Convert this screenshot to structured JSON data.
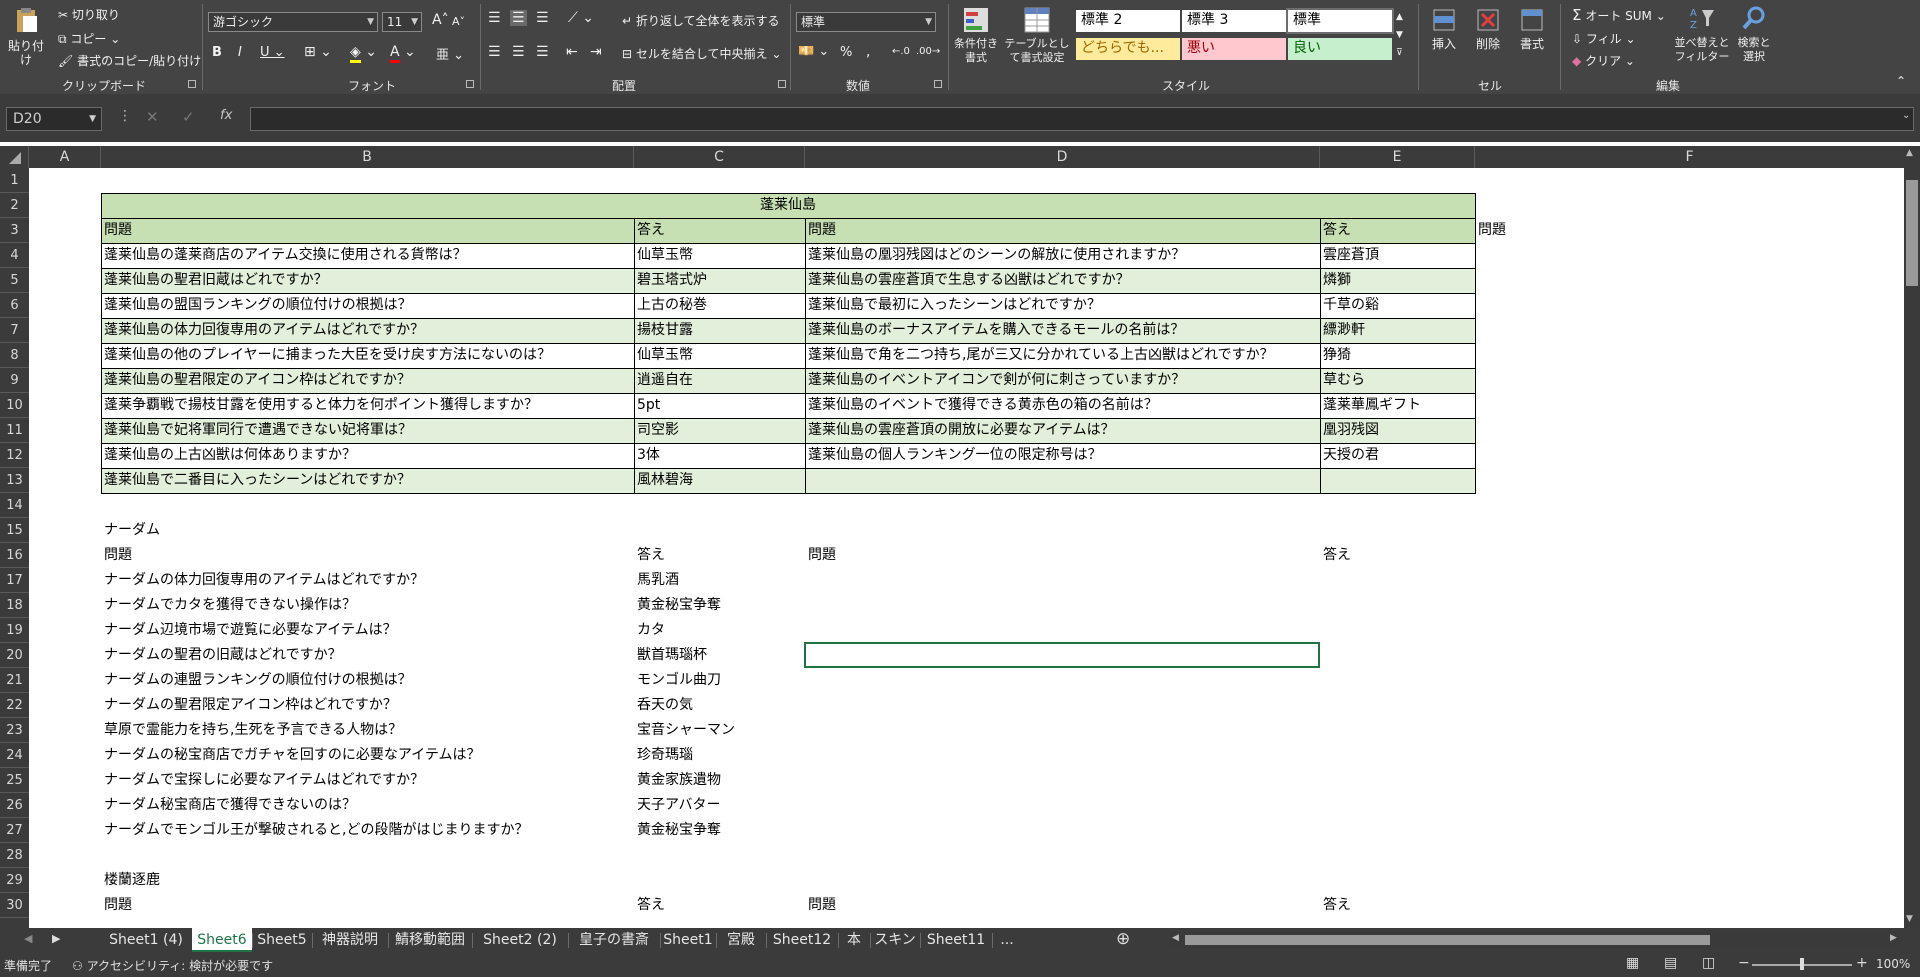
{
  "ribbon": {
    "clipboard": {
      "paste": "貼り付け",
      "cut": "切り取り",
      "copy": "コピー",
      "format_painter": "書式のコピー/貼り付け",
      "label": "クリップボード"
    },
    "font": {
      "name": "游ゴシック",
      "size": "11",
      "bold": "B",
      "italic": "I",
      "underline": "U",
      "grow": "A",
      "shrink": "A",
      "label": "フォント"
    },
    "alignment": {
      "wrap": "折り返して全体を表示する",
      "merge": "セルを結合して中央揃え",
      "label": "配置"
    },
    "number": {
      "format": "標準",
      "percent": "%",
      "comma": ",",
      "label": "数値"
    },
    "styles": {
      "conditional": "条件付き書式",
      "table": "テーブルとして書式設定",
      "items": [
        "標準 2",
        "標準 3",
        "標準",
        "どちらでも...",
        "悪い",
        "良い"
      ],
      "colors": {
        "neutral_bg": "#ffeb9c",
        "neutral_fg": "#9c6500",
        "bad_bg": "#ffc7ce",
        "bad_fg": "#9c0006",
        "good_bg": "#c6efce",
        "good_fg": "#006100"
      },
      "label": "スタイル"
    },
    "cells": {
      "insert": "挿入",
      "delete": "削除",
      "format": "書式",
      "label": "セル"
    },
    "editing": {
      "autosum": "オート SUM",
      "fill": "フィル",
      "clear": "クリア",
      "sort": "並べ替えとフィルター",
      "find": "検索と選択",
      "label": "編集"
    }
  },
  "formula_bar": {
    "name_box": "D20",
    "fx": "fx",
    "value": ""
  },
  "columns": [
    "A",
    "B",
    "C",
    "D",
    "E",
    "F"
  ],
  "rows": [
    "1",
    "2",
    "3",
    "4",
    "5",
    "6",
    "7",
    "8",
    "9",
    "10",
    "11",
    "12",
    "13",
    "14",
    "15",
    "16",
    "17",
    "18",
    "19",
    "20",
    "21",
    "22",
    "23",
    "24",
    "25",
    "26",
    "27",
    "28",
    "29",
    "30"
  ],
  "section1": {
    "title": "蓬莱仙島",
    "header_q": "問題",
    "header_a": "答え",
    "extra_header": "問題",
    "left": [
      {
        "q": "蓬莱仙島の蓬莱商店のアイテム交換に使用される貨幣は？",
        "a": "仙草玉幣"
      },
      {
        "q": "蓬莱仙島の聖君旧蔵はどれですか？",
        "a": "碧玉塔式炉"
      },
      {
        "q": "蓬莱仙島の盟国ランキングの順位付けの根拠は？",
        "a": "上古の秘巻"
      },
      {
        "q": "蓬莱仙島の体力回復専用のアイテムはどれですか？",
        "a": "揚枝甘露"
      },
      {
        "q": "蓬莱仙島の他のプレイヤーに捕まった大臣を受け戻す方法にないのは？",
        "a": "仙草玉幣"
      },
      {
        "q": "蓬莱仙島の聖君限定のアイコン枠はどれですか？",
        "a": "逍遥自在"
      },
      {
        "q": "蓬莱争覇戦で揚枝甘露を使用すると体力を何ポイント獲得しますか？",
        "a": "5pt"
      },
      {
        "q": "蓬莱仙島で妃将軍同行で遭遇できない妃将軍は？",
        "a": "司空影"
      },
      {
        "q": "蓬莱仙島の上古凶獣は何体ありますか？",
        "a": "3体"
      },
      {
        "q": "蓬莱仙島で二番目に入ったシーンはどれですか？",
        "a": "風林碧海"
      }
    ],
    "right": [
      {
        "q": "蓬莱仙島の凰羽残図はどのシーンの解放に使用されますか？",
        "a": "雲座蒼頂"
      },
      {
        "q": "蓬莱仙島の雲座蒼頂で生息する凶獣はどれですか？",
        "a": "燐獅"
      },
      {
        "q": "蓬莱仙島で最初に入ったシーンはどれですか？",
        "a": "千草の谿"
      },
      {
        "q": "蓬莱仙島のボーナスアイテムを購入できるモールの名前は？",
        "a": "縹渺軒"
      },
      {
        "q": "蓬莱仙島で角を二つ持ち,尾が三又に分かれている上古凶獣はどれですか？",
        "a": "狰猗"
      },
      {
        "q": "蓬莱仙島のイベントアイコンで剣が何に刺さっていますか？",
        "a": "草むら"
      },
      {
        "q": "蓬莱仙島のイベントで獲得できる黄赤色の箱の名前は？",
        "a": "蓬莱華鳳ギフト"
      },
      {
        "q": "蓬莱仙島の雲座蒼頂の開放に必要なアイテムは？",
        "a": "凰羽残図"
      },
      {
        "q": "蓬莱仙島の個人ランキング一位の限定称号は？",
        "a": "天授の君"
      },
      {
        "q": "",
        "a": ""
      }
    ]
  },
  "section2": {
    "title": "ナーダム",
    "header_q": "問題",
    "header_a": "答え",
    "header_q2": "問題",
    "header_a2": "答え",
    "items": [
      {
        "q": "ナーダムの体力回復専用のアイテムはどれですか？",
        "a": "馬乳酒"
      },
      {
        "q": "ナーダムでカタを獲得できない操作は？",
        "a": "黄金秘宝争奪"
      },
      {
        "q": "ナーダム辺境市場で遊覧に必要なアイテムは？",
        "a": "カタ"
      },
      {
        "q": "ナーダムの聖君の旧蔵はどれですか？",
        "a": "獣首瑪瑙杯"
      },
      {
        "q": "ナーダムの連盟ランキングの順位付けの根拠は？",
        "a": "モンゴル曲刀"
      },
      {
        "q": "ナーダムの聖君限定アイコン枠はどれですか？",
        "a": "呑天の気"
      },
      {
        "q": "草原で霊能力を持ち,生死を予言できる人物は？",
        "a": "宝音シャーマン"
      },
      {
        "q": "ナーダムの秘宝商店でガチャを回すのに必要なアイテムは？",
        "a": "珍奇瑪瑙"
      },
      {
        "q": "ナーダムで宝探しに必要なアイテムはどれですか？",
        "a": "黄金家族遺物"
      },
      {
        "q": "ナーダム秘宝商店で獲得できないのは？",
        "a": "天子アバター"
      },
      {
        "q": "ナーダムでモンゴル王が撃破されると,どの段階がはじまりますか？",
        "a": "黄金秘宝争奪"
      }
    ]
  },
  "section3": {
    "title": "楼蘭逐鹿",
    "header_q": "問題",
    "header_a": "答え",
    "header_q2": "問題",
    "header_a2": "答え"
  },
  "table_colors": {
    "header_green": "#c6e0b4",
    "band_green": "#e2efda"
  },
  "tabs": [
    "Sheet1 (4)",
    "Sheet6",
    "Sheet5",
    "神器説明",
    "鯖移動範囲",
    "Sheet2 (2)",
    "皇子の書斎",
    "Sheet1",
    "宮殿",
    "Sheet12",
    "本",
    "スキン",
    "Sheet11",
    "..."
  ],
  "active_tab": "Sheet6",
  "status": {
    "ready": "準備完了",
    "accessibility": "アクセシビリティ: 検討が必要です",
    "zoom": "100%"
  }
}
